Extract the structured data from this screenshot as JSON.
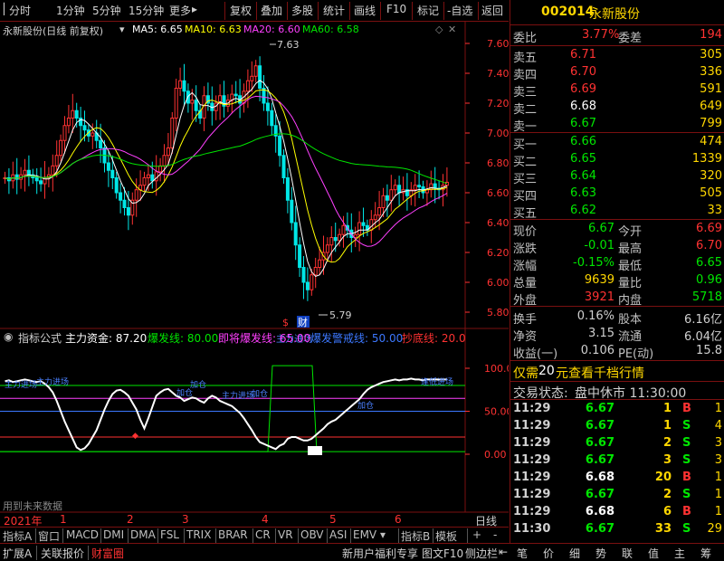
{
  "toolbar": {
    "items": [
      "分时",
      "1分钟",
      "5分钟",
      "15分钟",
      "更多",
      "复权",
      "叠加",
      "多股",
      "统计",
      "画线",
      "F10",
      "标记",
      "-自选",
      "返回"
    ],
    "more_arrow": "▸"
  },
  "main_chart": {
    "title": "永新股份(日线 前复权)",
    "ma": [
      {
        "label": "MA5: 6.65",
        "color": "#ffffff"
      },
      {
        "label": "MA10: 6.63",
        "color": "#ffff00"
      },
      {
        "label": "MA20: 6.60",
        "color": "#ff40ff"
      },
      {
        "label": "MA60: 6.58",
        "color": "#00e600"
      }
    ],
    "price_ticks": [
      "7.60",
      "7.40",
      "7.20",
      "7.00",
      "6.80",
      "6.60",
      "6.40",
      "6.20",
      "6.00",
      "5.80"
    ],
    "high_label": "7.63",
    "low_label": "5.79",
    "marker_dollar": "$",
    "marker_cai": "财"
  },
  "indicator": {
    "name": "指标公式",
    "lines": [
      {
        "label": "主力资金: 87.20",
        "color": "#ffffff"
      },
      {
        "label": "爆发线: 80.00",
        "color": "#00e600"
      },
      {
        "label": "即将爆发线: 65.00",
        "color": "#ff40ff"
      },
      {
        "label": "爆发警戒线: 50.00",
        "color": "#3c78ff"
      },
      {
        "label": "抄底线: 20.00",
        "color": "#ff3232"
      }
    ],
    "ticks": [
      "100.0",
      "50.00",
      "0.00"
    ],
    "cut_label": "主力进场",
    "note": "用到未来数据",
    "tags": [
      "主力进场",
      "主力进场",
      "加仓",
      "加仓",
      "主力进场",
      "加仓",
      "加仓",
      "逢低进场"
    ]
  },
  "timeline": {
    "year": "2021年",
    "months": [
      "1",
      "2",
      "3",
      "4",
      "5",
      "6"
    ],
    "period": "日线"
  },
  "tabs": [
    "指标A",
    "窗口",
    "MACD",
    "DMI",
    "DMA",
    "FSL",
    "TRIX",
    "BRAR",
    "CR",
    "VR",
    "OBV",
    "ASI",
    "EMV",
    "指标B",
    "模板",
    "+",
    "-"
  ],
  "stock": {
    "code": "002014",
    "name": "永新股份"
  },
  "order_book": {
    "weibi_label": "委比",
    "weibi": "3.77%",
    "weicha_label": "委差",
    "weicha": "194",
    "asks": [
      {
        "label": "卖五",
        "price": "6.71",
        "vol": "305"
      },
      {
        "label": "卖四",
        "price": "6.70",
        "vol": "336"
      },
      {
        "label": "卖三",
        "price": "6.69",
        "vol": "591"
      },
      {
        "label": "卖二",
        "price": "6.68",
        "vol": "649"
      },
      {
        "label": "卖一",
        "price": "6.67",
        "vol": "799"
      }
    ],
    "bids": [
      {
        "label": "买一",
        "price": "6.66",
        "vol": "474"
      },
      {
        "label": "买二",
        "price": "6.65",
        "vol": "1339"
      },
      {
        "label": "买三",
        "price": "6.64",
        "vol": "320"
      },
      {
        "label": "买四",
        "price": "6.63",
        "vol": "505"
      },
      {
        "label": "买五",
        "price": "6.62",
        "vol": "33"
      }
    ]
  },
  "quote": [
    {
      "l1": "现价",
      "v1": "6.67",
      "l2": "今开",
      "v2": "6.69",
      "c1": "#00e600",
      "c2": "#ff3232"
    },
    {
      "l1": "涨跌",
      "v1": "-0.01",
      "l2": "最高",
      "v2": "6.70",
      "c1": "#00e600",
      "c2": "#ff3232"
    },
    {
      "l1": "涨幅",
      "v1": "-0.15%",
      "l2": "最低",
      "v2": "6.65",
      "c1": "#00e600",
      "c2": "#00e600"
    },
    {
      "l1": "总量",
      "v1": "9639",
      "l2": "量比",
      "v2": "0.96",
      "c1": "#ffd700",
      "c2": "#00e600"
    },
    {
      "l1": "外盘",
      "v1": "3921",
      "l2": "内盘",
      "v2": "5718",
      "c1": "#ff3232",
      "c2": "#00e600"
    }
  ],
  "fin": [
    {
      "l1": "换手",
      "v1": "0.16%",
      "l2": "股本",
      "v2": "6.16亿"
    },
    {
      "l1": "净资",
      "v1": "3.15",
      "l2": "流通",
      "v2": "6.04亿"
    },
    {
      "l1": "收益(一)",
      "v1": "0.106",
      "l2": "PE(动)",
      "v2": "15.8"
    }
  ],
  "promo": {
    "pre": "仅需",
    "num": "20",
    "post": "元查看千档行情"
  },
  "status": {
    "label": "交易状态:",
    "value": "盘中休市 11:30:00"
  },
  "ticks": [
    {
      "t": "11:29",
      "p": "6.67",
      "v": "1",
      "bs": "B",
      "n": "1",
      "pc": "#00e600",
      "bc": "#ff3232"
    },
    {
      "t": "11:29",
      "p": "6.67",
      "v": "1",
      "bs": "S",
      "n": "4",
      "pc": "#00e600",
      "bc": "#00e600"
    },
    {
      "t": "11:29",
      "p": "6.67",
      "v": "2",
      "bs": "S",
      "n": "3",
      "pc": "#00e600",
      "bc": "#00e600"
    },
    {
      "t": "11:29",
      "p": "6.67",
      "v": "3",
      "bs": "S",
      "n": "3",
      "pc": "#00e600",
      "bc": "#00e600"
    },
    {
      "t": "11:29",
      "p": "6.68",
      "v": "20",
      "bs": "B",
      "n": "1",
      "pc": "#ffffff",
      "bc": "#ff3232"
    },
    {
      "t": "11:29",
      "p": "6.67",
      "v": "2",
      "bs": "S",
      "n": "1",
      "pc": "#00e600",
      "bc": "#00e600"
    },
    {
      "t": "11:29",
      "p": "6.68",
      "v": "6",
      "bs": "B",
      "n": "1",
      "pc": "#ffffff",
      "bc": "#ff3232"
    },
    {
      "t": "11:30",
      "p": "6.67",
      "v": "33",
      "bs": "S",
      "n": "29",
      "pc": "#00e600",
      "bc": "#00e600"
    }
  ],
  "bottom_left": [
    "扩展A",
    "关联报价",
    "财富圈"
  ],
  "bottom_mid": [
    "新用户福利专享",
    "图文F10",
    "侧边栏"
  ],
  "bottom_right": [
    "笔",
    "价",
    "细",
    "势",
    "联",
    "值",
    "主",
    "筹"
  ]
}
